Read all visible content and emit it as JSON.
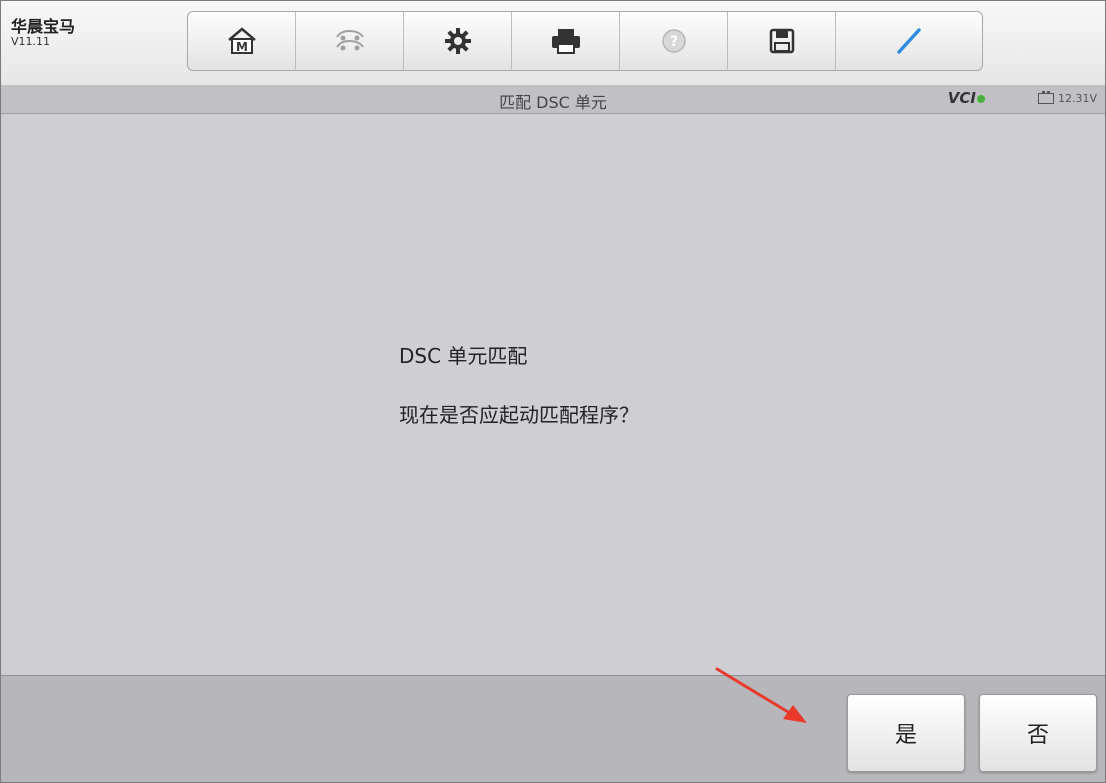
{
  "app": {
    "name": "华晨宝马",
    "version": "V11.11"
  },
  "toolbar": {
    "buttons": [
      {
        "icon": "home-icon"
      },
      {
        "icon": "vehicle-swap-icon"
      },
      {
        "icon": "settings-gear-icon"
      },
      {
        "icon": "print-icon"
      },
      {
        "icon": "help-icon"
      },
      {
        "icon": "save-icon"
      },
      {
        "icon": "pen-icon"
      }
    ]
  },
  "titlebar": {
    "title": "匹配 DSC 单元",
    "vci_label": "VCI",
    "battery_voltage": "12.31V"
  },
  "dialog": {
    "heading": "DSC 单元匹配",
    "question": "现在是否应起动匹配程序？"
  },
  "actions": {
    "yes_label": "是",
    "no_label": "否"
  },
  "colors": {
    "background": "#cfcfd3",
    "arrow": "#e8392c",
    "vci_dot": "#49b13f",
    "pen_accent": "#2e8de0"
  }
}
